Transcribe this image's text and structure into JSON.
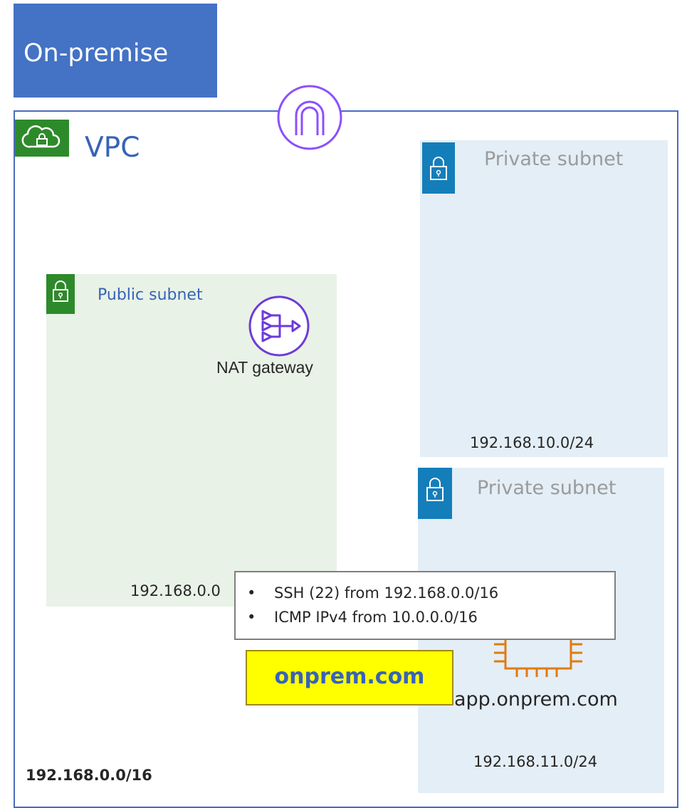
{
  "on_premise": {
    "label": "On-premise"
  },
  "vpc": {
    "label": "VPC",
    "cidr": "192.168.0.0/16",
    "icon": "cloud-lock-icon"
  },
  "public_subnet": {
    "label": "Public subnet",
    "cidr": "192.168.0.0/24",
    "visible_cidr": "192.168.0.0",
    "nat_gateway": {
      "label": "NAT gateway",
      "icon": "nat-gateway-icon"
    }
  },
  "private_subnets": [
    {
      "label": "Private subnet",
      "cidr": "192.168.10.0/24"
    },
    {
      "label": "Private subnet",
      "cidr": "192.168.11.0/24",
      "host": "app.onprem.com",
      "host_icon": "ec2-instance-icon"
    }
  ],
  "security_group_rules": [
    "SSH (22) from 192.168.0.0/16",
    "ICMP IPv4 from 10.0.0.0/16"
  ],
  "domain": "onprem.com",
  "colors": {
    "on_premise_bg": "#4472c4",
    "vpc_border": "#4a6bbd",
    "public_green": "#2d8a2a",
    "public_subnet_bg": "#e8f2e6",
    "private_blue": "#147eba",
    "private_subnet_bg": "#e4eef6",
    "tunnel_purple": "#8c4fff",
    "nat_purple": "#6d3bd8",
    "ec2_orange": "#e07b12",
    "domain_yellow": "#ffff00"
  }
}
